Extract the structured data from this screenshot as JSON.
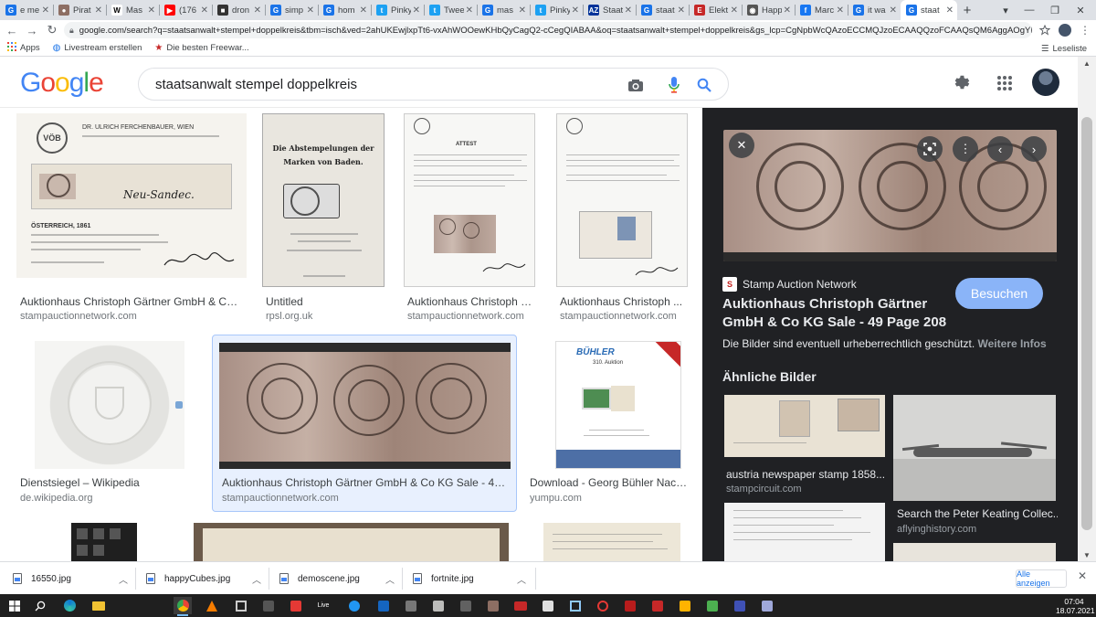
{
  "browser": {
    "tabs": [
      {
        "label": "e me",
        "color": "#1a73e8",
        "glyph": "G"
      },
      {
        "label": "Pirat",
        "color": "#8d6e63",
        "glyph": "●"
      },
      {
        "label": "Mas",
        "color": "#ffffff",
        "glyph": "W"
      },
      {
        "label": "(176",
        "color": "#ff0000",
        "glyph": "▶"
      },
      {
        "label": "dron",
        "color": "#333333",
        "glyph": "■"
      },
      {
        "label": "simp",
        "color": "#1a73e8",
        "glyph": "G"
      },
      {
        "label": "hom",
        "color": "#1a73e8",
        "glyph": "G"
      },
      {
        "label": "Pinky",
        "color": "#1da1f2",
        "glyph": "t"
      },
      {
        "label": "Twee",
        "color": "#1da1f2",
        "glyph": "t"
      },
      {
        "label": "mas",
        "color": "#1a73e8",
        "glyph": "G"
      },
      {
        "label": "Pinky",
        "color": "#1da1f2",
        "glyph": "t"
      },
      {
        "label": "Staat",
        "color": "#003399",
        "glyph": "AZ"
      },
      {
        "label": "staat",
        "color": "#1a73e8",
        "glyph": "G"
      },
      {
        "label": "Elekt",
        "color": "#c62828",
        "glyph": "E"
      },
      {
        "label": "Happ",
        "color": "#555555",
        "glyph": "◉"
      },
      {
        "label": "Marc",
        "color": "#1877f2",
        "glyph": "f"
      },
      {
        "label": "it wa",
        "color": "#1a73e8",
        "glyph": "G"
      },
      {
        "label": "staat",
        "color": "#1a73e8",
        "glyph": "G"
      }
    ],
    "active_tab": 17,
    "url": "google.com/search?q=staatsanwalt+stempel+doppelkreis&tbm=isch&ved=2ahUKEwjlxpTt6-vxAhWOOewKHbQyCagQ2-cCegQIABAA&oq=staatsanwalt+stempel+doppelkreis&gs_lcp=CgNpbWcQAzoECCMQJzoECAAQQzoFCAAQsQM6AggAOgYIABAFEB46...",
    "bookmarks": [
      {
        "label": "Apps",
        "icon": "apps-grid-icon"
      },
      {
        "label": "Livestream erstellen",
        "icon": "globe-icon"
      },
      {
        "label": "Die besten Freewar...",
        "icon": "star-icon"
      }
    ],
    "reading_list": "Leseliste"
  },
  "google": {
    "query": "staatsanwalt stempel doppelkreis"
  },
  "results": [
    {
      "title": "Auktionhaus Christoph Gärtner GmbH & Co K...",
      "source": "stampauctionnetwork.com",
      "kind": "certificate"
    },
    {
      "title": "Untitled",
      "source": "rpsl.org.uk",
      "kind": "booklet"
    },
    {
      "title": "Auktionhaus Christoph G...",
      "source": "stampauctionnetwork.com",
      "kind": "attest"
    },
    {
      "title": "Auktionhaus Christoph ...",
      "source": "stampauctionnetwork.com",
      "kind": "attest"
    },
    {
      "title": "Dienstsiegel – Wikipedia",
      "source": "de.wikipedia.org",
      "kind": "seal"
    },
    {
      "title": "Auktionhaus Christoph Gärtner GmbH & Co KG Sale - 49 P...",
      "source": "stampauctionnetwork.com",
      "kind": "stamps",
      "selected": true
    },
    {
      "title": "Download - Georg Bühler Nach...",
      "source": "yumpu.com",
      "kind": "catalog"
    }
  ],
  "thumb_text": {
    "certificate_name": "Neu-Sandec.",
    "certificate_header": "DR. ULRICH FERCHENBAUER, WIEN",
    "certificate_country": "ÖSTERREICH, 1861",
    "booklet_title": "Die Abstempelungen der Marken von Baden.",
    "attest_heading": "ATTEST",
    "catalog_brand": "BÜHLER",
    "catalog_auction": "310. Auktion"
  },
  "panel": {
    "source": "Stamp Auction Network",
    "title": "Auktionhaus Christoph Gärtner GmbH & Co KG Sale - 49 Page 208",
    "visit": "Besuchen",
    "copyright": "Die Bilder sind eventuell urheberrechtlich geschützt.",
    "more_info": "Weitere Infos",
    "similar_heading": "Ähnliche Bilder",
    "similar": [
      {
        "title": "austria newspaper stamp 1858...",
        "source": "stampcircuit.com"
      },
      {
        "title": "Search the Peter Keating Collec...",
        "source": "aflyinghistory.com"
      }
    ]
  },
  "downloads": [
    {
      "name": "16550.jpg"
    },
    {
      "name": "happyCubes.jpg"
    },
    {
      "name": "demoscene.jpg"
    },
    {
      "name": "fortnite.jpg"
    }
  ],
  "downloads_show_all": "Alle anzeigen",
  "clock": {
    "time": "07:04",
    "date": "18.07.2021"
  }
}
